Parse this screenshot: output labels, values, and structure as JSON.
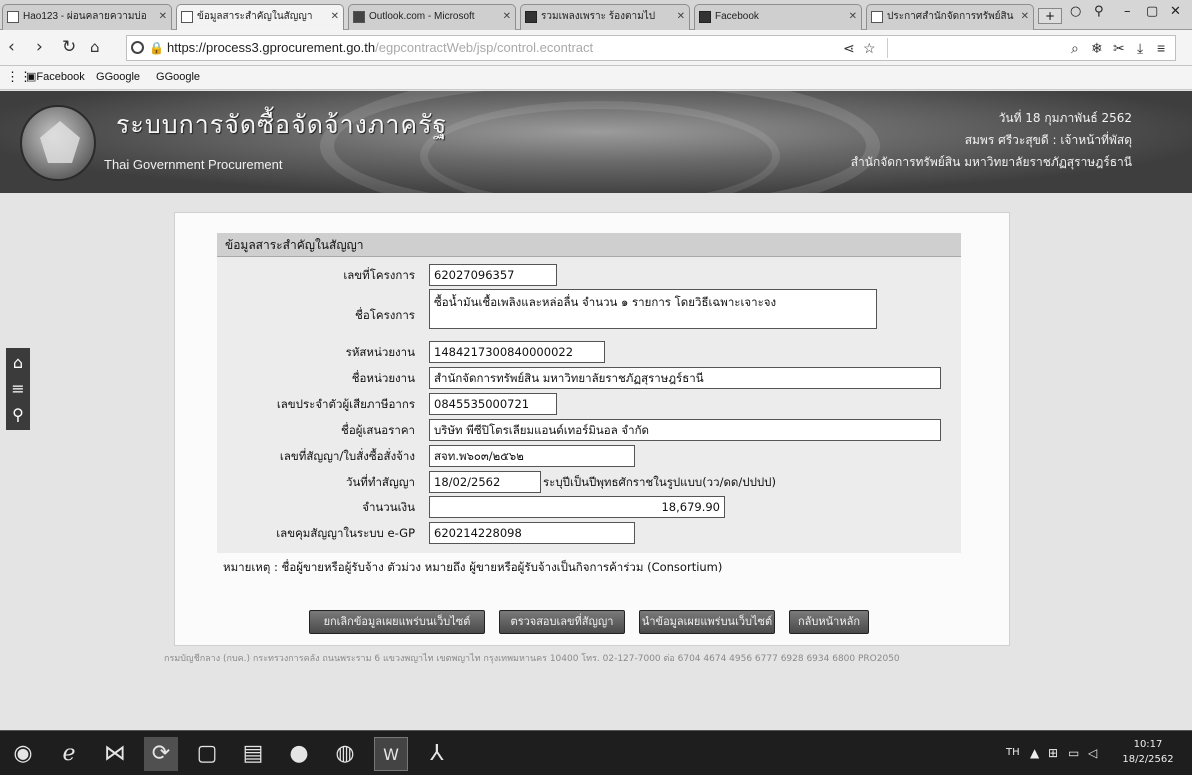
{
  "browser": {
    "tabs": [
      {
        "label": "Hao123 - ผ่อนคลายความบ่อ",
        "icon": "hao123-icon"
      },
      {
        "label": "ข้อมูลสาระสำคัญในสัญญา",
        "icon": "page-icon"
      },
      {
        "label": "Outlook.com - Microsoft",
        "icon": "outlook-icon"
      },
      {
        "label": "รวมเพลงเพราะ ร้องตามไป",
        "icon": "video-icon"
      },
      {
        "label": "Facebook",
        "icon": "facebook-icon"
      },
      {
        "label": "ประกาศสำนักจัดการทรัพย์สิน",
        "icon": "page-icon"
      }
    ],
    "url_host": "https://process3.gprocurement.go.th",
    "url_path": "/egpcontractWeb/jsp/control.econtract",
    "bookmarks": [
      "Facebook",
      "Google",
      "Google"
    ]
  },
  "header": {
    "title": "ระบบการจัดซื้อจัดจ้างภาครัฐ",
    "subtitle": "Thai Government Procurement",
    "date": "วันที่ 18 กุมภาพันธ์ 2562",
    "user": "สมพร ศรีวะสุขดี : เจ้าหน้าที่พัสดุ",
    "org": "สำนักจัดการทรัพย์สิน มหาวิทยาลัยราชภัฏสุราษฎร์ธานี"
  },
  "form": {
    "section_title": "ข้อมูลสาระสำคัญในสัญญา",
    "fields": {
      "project_no": {
        "label": "เลขที่โครงการ",
        "value": "62027096357"
      },
      "project_name": {
        "label": "ชื่อโครงการ",
        "value": "ซื้อน้ำมันเชื้อเพลิงและหล่อลื่น จำนวน ๑ รายการ โดยวิธีเฉพาะเจาะจง"
      },
      "agency_code": {
        "label": "รหัสหน่วยงาน",
        "value": "1484217300840000022"
      },
      "agency_name": {
        "label": "ชื่อหน่วยงาน",
        "value": "สำนักจัดการทรัพย์สิน มหาวิทยาลัยราชภัฏสุราษฎร์ธานี"
      },
      "tax_id": {
        "label": "เลขประจำตัวผู้เสียภาษีอากร",
        "value": "0845535000721"
      },
      "bidder": {
        "label": "ชื่อผู้เสนอราคา",
        "value": "บริษัท พีซีปิโตรเลียมแอนด์เทอร์มินอล จำกัด"
      },
      "contract_no": {
        "label": "เลขที่สัญญา/ใบสั่งซื้อสั่งจ้าง",
        "value": "สจท.พ๖๐๓/๒๕๖๒"
      },
      "contract_date": {
        "label": "วันที่ทำสัญญา",
        "value": "18/02/2562",
        "note": "ระบุปีเป็นปีพุทธศักราชในรูปแบบ(วว/ดด/ปปปป)"
      },
      "amount": {
        "label": "จำนวนเงิน",
        "value": "18,679.90"
      },
      "egp_contract_no": {
        "label": "เลขคุมสัญญาในระบบ e-GP",
        "value": "620214228098"
      }
    },
    "footnote": "หมายเหตุ : ชื่อผู้ขายหรือผู้รับจ้าง ตัวม่วง หมายถึง ผู้ขายหรือผู้รับจ้างเป็นกิจการค้าร่วม (Consortium)",
    "buttons": {
      "cancel_publish": "ยกเลิกข้อมูลเผยแพร่บนเว็บไซต์",
      "view_contract": "ตรวจสอบเลขที่สัญญา",
      "publish": "นำข้อมูลเผยแพร่บนเว็บไซต์",
      "back": "กลับหน้าหลัก"
    }
  },
  "footer": {
    "text": "กรมบัญชีกลาง (กบค.) กระทรวงการคลัง ถนนพระราม 6 แขวงพญาไท เขตพญาไท กรุงเทพมหานคร 10400 โทร. 02-127-7000 ต่อ 6704 4674 4956 6777 6928 6934 6800     PRO2050"
  },
  "taskbar": {
    "lang": "TH",
    "time": "10:17",
    "date": "18/2/2562"
  }
}
